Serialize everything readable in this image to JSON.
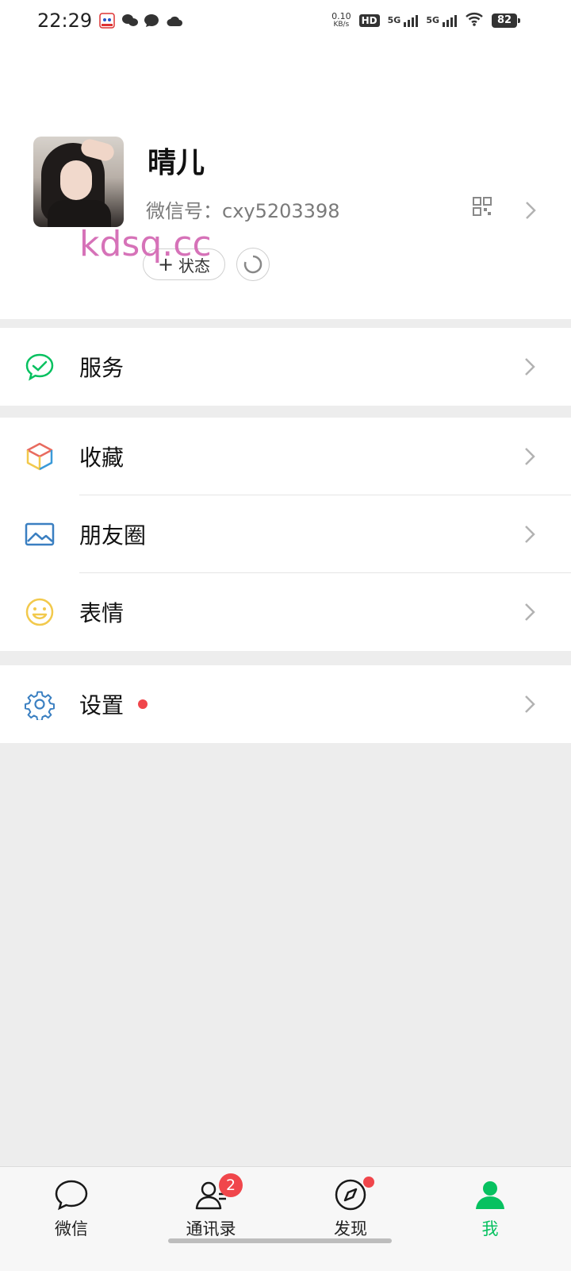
{
  "status_bar": {
    "time": "22:29",
    "net_speed_value": "0.10",
    "net_speed_unit": "KB/s",
    "hd_label": "HD",
    "signal_1_label": "5G",
    "signal_2_label": "5G",
    "battery": "82"
  },
  "profile": {
    "nickname": "晴儿",
    "wechat_id": "微信号：cxy5203398",
    "status_button_label": "状态",
    "watermark": "kdsq.cc"
  },
  "menu": {
    "service": "服务",
    "favorites": "收藏",
    "moments": "朋友圈",
    "stickers": "表情",
    "settings": "设置"
  },
  "tabbar": {
    "tabs": [
      {
        "label": "微信"
      },
      {
        "label": "通讯录",
        "badge": "2"
      },
      {
        "label": "发现"
      },
      {
        "label": "我"
      }
    ]
  },
  "colors": {
    "accent_green": "#07c160",
    "badge_red": "#f0464b"
  }
}
